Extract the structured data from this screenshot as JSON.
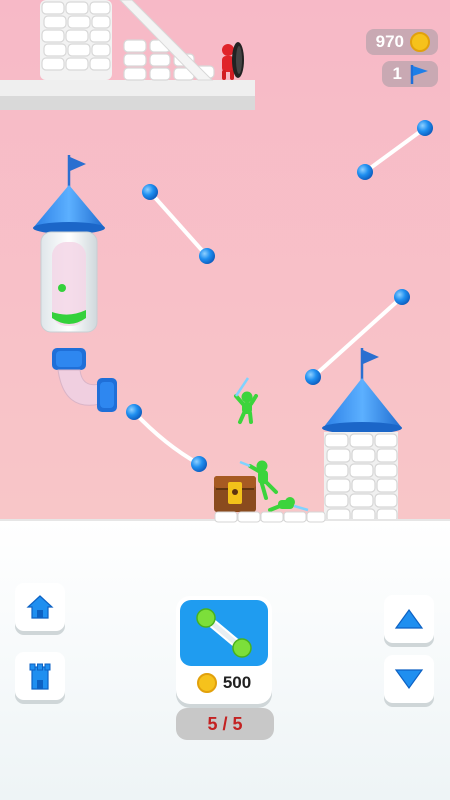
{
  "hud": {
    "coins": "970",
    "level": "1",
    "coin_icon": "gold-coin-icon",
    "flag_icon": "blue-flag-icon"
  },
  "shop_card": {
    "icon": "rope-connector-icon",
    "price": "500",
    "coin_icon": "gold-coin-icon"
  },
  "counter": {
    "text": "5 / 5"
  },
  "buttons": {
    "left_top_icon": "house-icon",
    "left_bottom_icon": "castle-icon",
    "right_top_icon": "arrow-up-icon",
    "right_bottom_icon": "arrow-down-icon"
  },
  "colors": {
    "sky_top": "#f6b9c6",
    "sky_bottom": "#f7c4c8",
    "ground": "#ffffff",
    "accent_blue": "#1f7fe0",
    "enemy_red": "#e0232a",
    "player_green": "#3cd43c"
  }
}
